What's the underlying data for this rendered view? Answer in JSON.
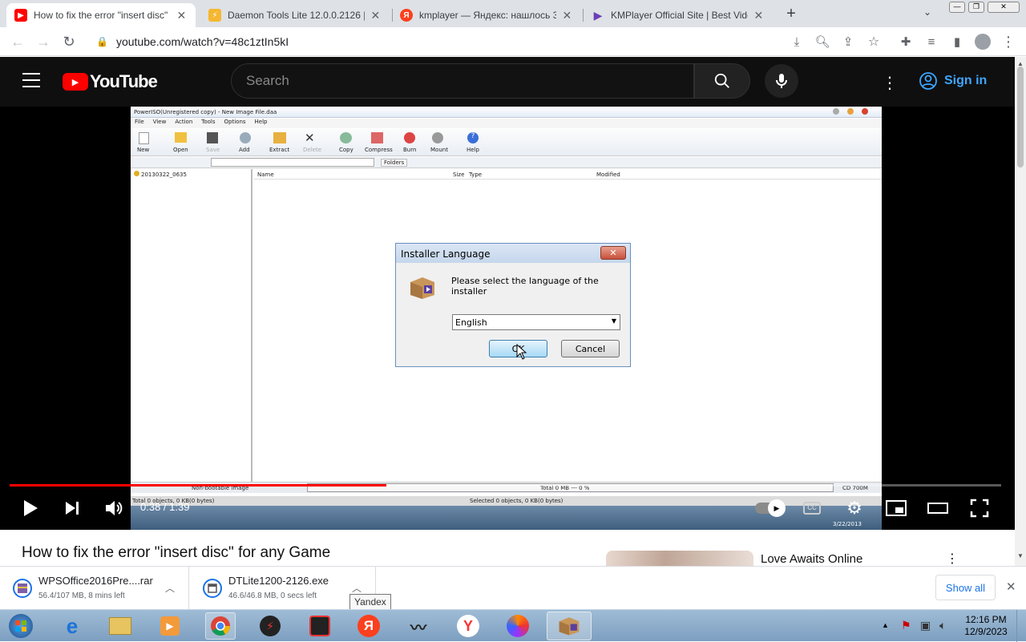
{
  "browser": {
    "tabs": [
      {
        "title": "How to fix the error \"insert disc\"",
        "favicon": "youtube-icon",
        "active": true
      },
      {
        "title": "Daemon Tools Lite 12.0.0.2126 | …",
        "favicon": "daemon-tools-icon",
        "active": false
      },
      {
        "title": "kmplayer — Яндекс: нашлось 3",
        "favicon": "yandex-icon",
        "active": false
      },
      {
        "title": "KMPlayer Official Site | Best Video",
        "favicon": "kmplayer-icon",
        "active": false
      }
    ],
    "url": "youtube.com/watch?v=48c1ztIn5kI"
  },
  "youtube": {
    "logo_text": "YouTube",
    "search_placeholder": "Search",
    "sign_in": "Sign in",
    "video_title": "How to fix the error \"insert disc\" for any Game",
    "sidebar_title": "Love Awaits Online"
  },
  "player": {
    "current_time": "0:38",
    "duration": "1:39",
    "time_display": "0:38 / 1:39",
    "progress": 0.38
  },
  "video_frame": {
    "window_title": "PowerISO(Unregistered copy) - New Image File.daa",
    "menu": [
      "File",
      "View",
      "Action",
      "Tools",
      "Options",
      "Help"
    ],
    "toolbar": [
      "New",
      "Open",
      "Save",
      "Add",
      "Extract",
      "Delete",
      "Copy",
      "Compress",
      "Burn",
      "Mount",
      "Help"
    ],
    "folders_label": "Folders",
    "tree_item": "20130322_0635",
    "columns": [
      "Name",
      "Size",
      "Type",
      "Modified"
    ],
    "status_left": "Non-bootable image",
    "status_total": "Total 0 MB  --- 0 %",
    "status_cd": "CD 700M",
    "status_objects": "Total 0 objects, 0 KB(0 bytes)",
    "status_selected": "Selected 0 objects, 0 KB(0 bytes)",
    "embedded_clock_date": "3/22/2013"
  },
  "dialog": {
    "title": "Installer Language",
    "prompt": "Please select the language of the installer",
    "language": "English",
    "ok": "OK",
    "cancel": "Cancel"
  },
  "downloads": [
    {
      "name": "WPSOffice2016Pre....rar",
      "status": "56.4/107 MB, 8 mins left"
    },
    {
      "name": "DTLite1200-2126.exe",
      "status": "46.6/46.8 MB, 0 secs left"
    }
  ],
  "downloads_show_all": "Show all",
  "tooltip": "Yandex",
  "taskbar": {
    "time": "12:16 PM",
    "date": "12/9/2023"
  },
  "colors": {
    "youtube_red": "#ff0000",
    "yt_dark": "#0f0f0f",
    "link_blue": "#3ea6ff"
  }
}
